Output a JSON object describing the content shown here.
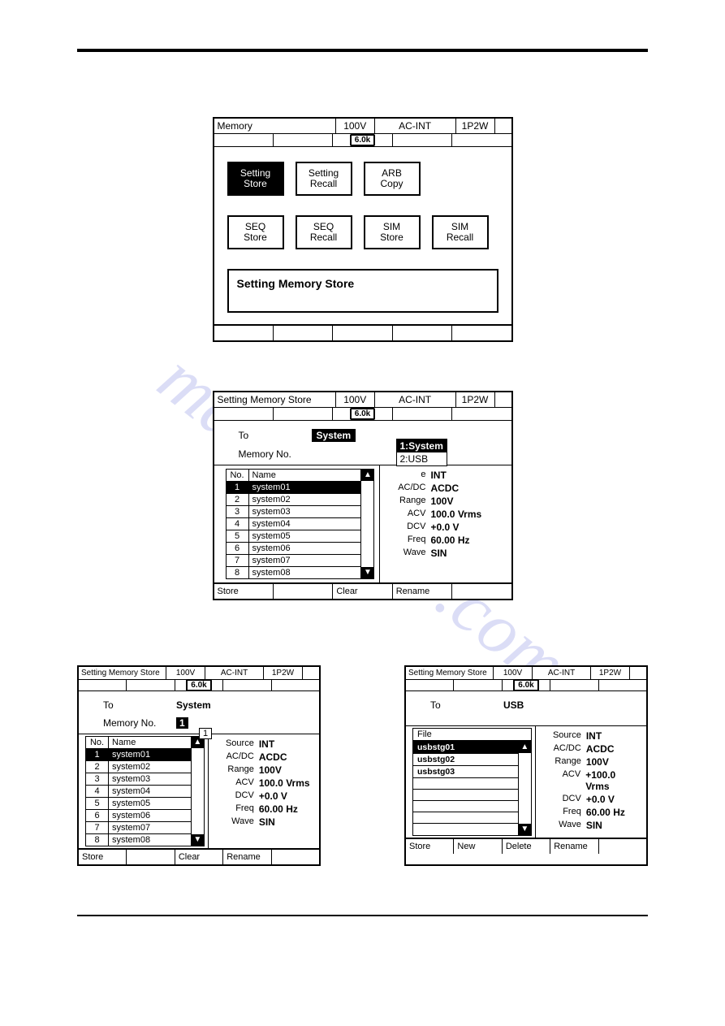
{
  "watermark_text": "manualslive.com",
  "panel1": {
    "title": "Memory",
    "volt": "100V",
    "mode": "AC-INT",
    "phase": "1P2W",
    "badge": "6.0k",
    "buttons_top": [
      {
        "l1": "Setting",
        "l2": "Store",
        "sel": true
      },
      {
        "l1": "Setting",
        "l2": "Recall",
        "sel": false
      },
      {
        "l1": "ARB",
        "l2": "Copy",
        "sel": false
      }
    ],
    "buttons_bot": [
      {
        "l1": "SEQ",
        "l2": "Store"
      },
      {
        "l1": "SEQ",
        "l2": "Recall"
      },
      {
        "l1": "SIM",
        "l2": "Store"
      },
      {
        "l1": "SIM",
        "l2": "Recall"
      }
    ],
    "desc": "Setting Memory Store"
  },
  "panel2": {
    "title": "Setting Memory Store",
    "volt": "100V",
    "mode": "AC-INT",
    "phase": "1P2W",
    "badge": "6.0k",
    "to_label": "To",
    "to_value": "System",
    "memno_label": "Memory No.",
    "dropdown": [
      {
        "label": "1:System",
        "sel": true
      },
      {
        "label": "2:USB",
        "sel": false
      }
    ],
    "list_head": {
      "no": "No.",
      "name": "Name"
    },
    "list": [
      {
        "no": "1",
        "name": "system01",
        "sel": true
      },
      {
        "no": "2",
        "name": "system02"
      },
      {
        "no": "3",
        "name": "system03"
      },
      {
        "no": "4",
        "name": "system04"
      },
      {
        "no": "5",
        "name": "system05"
      },
      {
        "no": "6",
        "name": "system06"
      },
      {
        "no": "7",
        "name": "system07"
      },
      {
        "no": "8",
        "name": "system08"
      }
    ],
    "props": [
      {
        "k": "e",
        "v": "INT"
      },
      {
        "k": "AC/DC",
        "v": "ACDC"
      },
      {
        "k": "Range",
        "v": "100V"
      },
      {
        "k": "ACV",
        "v": "100.0 Vrms"
      },
      {
        "k": "DCV",
        "v": "+0.0 V"
      },
      {
        "k": "Freq",
        "v": "60.00 Hz"
      },
      {
        "k": "Wave",
        "v": "SIN"
      }
    ],
    "soft": [
      "Store",
      "",
      "Clear",
      "Rename",
      ""
    ]
  },
  "panel3": {
    "title": "Setting Memory Store",
    "volt": "100V",
    "mode": "AC-INT",
    "phase": "1P2W",
    "badge": "6.0k",
    "to_label": "To",
    "to_value": "System",
    "memno_label": "Memory No.",
    "memno_value": "1",
    "memno_popup": "1",
    "list_head": {
      "no": "No.",
      "name": "Name"
    },
    "list": [
      {
        "no": "1",
        "name": "system01",
        "sel": true
      },
      {
        "no": "2",
        "name": "system02"
      },
      {
        "no": "3",
        "name": "system03"
      },
      {
        "no": "4",
        "name": "system04"
      },
      {
        "no": "5",
        "name": "system05"
      },
      {
        "no": "6",
        "name": "system06"
      },
      {
        "no": "7",
        "name": "system07"
      },
      {
        "no": "8",
        "name": "system08"
      }
    ],
    "props": [
      {
        "k": "Source",
        "v": "INT"
      },
      {
        "k": "AC/DC",
        "v": "ACDC"
      },
      {
        "k": "Range",
        "v": "100V"
      },
      {
        "k": "ACV",
        "v": "100.0 Vrms"
      },
      {
        "k": "DCV",
        "v": "+0.0 V"
      },
      {
        "k": "Freq",
        "v": "60.00 Hz"
      },
      {
        "k": "Wave",
        "v": "SIN"
      }
    ],
    "soft": [
      "Store",
      "",
      "Clear",
      "Rename",
      ""
    ]
  },
  "panel4": {
    "title": "Setting Memory Store",
    "volt": "100V",
    "mode": "AC-INT",
    "phase": "1P2W",
    "badge": "6.0k",
    "to_label": "To",
    "to_value": "USB",
    "file_head": "File",
    "files": [
      {
        "name": "usbstg01",
        "sel": true
      },
      {
        "name": "usbstg02"
      },
      {
        "name": "usbstg03"
      }
    ],
    "empty_rows": 5,
    "props": [
      {
        "k": "Source",
        "v": "INT"
      },
      {
        "k": "AC/DC",
        "v": "ACDC"
      },
      {
        "k": "Range",
        "v": "100V"
      },
      {
        "k": "ACV",
        "v": "+100.0 Vrms"
      },
      {
        "k": "DCV",
        "v": "+0.0 V"
      },
      {
        "k": "Freq",
        "v": "60.00 Hz"
      },
      {
        "k": "Wave",
        "v": "SIN"
      }
    ],
    "soft": [
      "Store",
      "New",
      "Delete",
      "Rename",
      ""
    ]
  },
  "scroll": {
    "up": "▲",
    "down": "▼"
  }
}
